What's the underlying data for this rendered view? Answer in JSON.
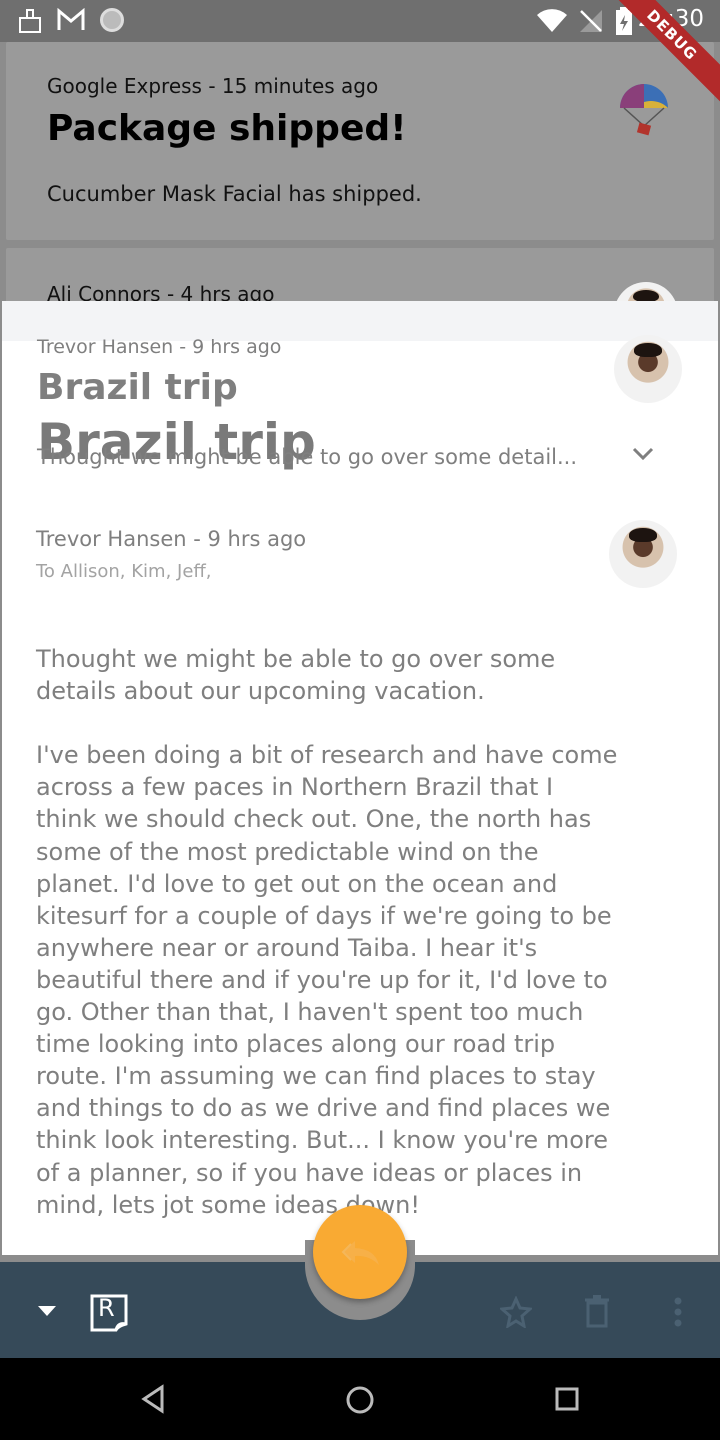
{
  "status_bar": {
    "time": "23:30",
    "debug_label": "DEBUG"
  },
  "background_list": [
    {
      "meta": "Google Express - 15 minutes ago",
      "title": "Package shipped!",
      "preview": "Cucumber Mask Facial has shipped."
    },
    {
      "meta": "Ali Connors - 4 hrs ago"
    }
  ],
  "collapsed_header": {
    "meta": "Trevor Hansen - 9 hrs ago",
    "title": "Brazil trip",
    "title_overlay": "Brazil trip",
    "preview": "Thought we might be able to go over some detail..."
  },
  "email": {
    "sender_line": "Trevor Hansen - 9 hrs ago",
    "recipients": "To Allison, Kim, Jeff,",
    "body_lines": [
      "Thought we might be able to go over some",
      "details about our upcoming vacation.",
      "",
      "I've been doing a bit of research and have come",
      "across a few paces in Northern Brazil that I",
      "think we should check out. One, the north has",
      "some of the most predictable wind on the",
      "planet. I'd love to get out on the ocean and",
      "kitesurf for a couple of days if we're going to be",
      "anywhere near or around Taiba. I hear it's",
      "beautiful there and if you're up for it, I'd love to",
      "go. Other than that, I haven't spent too much",
      "time looking into places along our road trip",
      "route. I'm assuming we can find places to stay",
      "and things to do as we drive and find places we",
      "think look interesting. But... I know you're more",
      "of a planner, so if you have ideas or places in",
      "mind, lets jot some ideas down!"
    ]
  },
  "app_bar": {
    "logo_letter": "R"
  },
  "colors": {
    "accent": "#f9aa33",
    "app_bar": "#364a59"
  }
}
